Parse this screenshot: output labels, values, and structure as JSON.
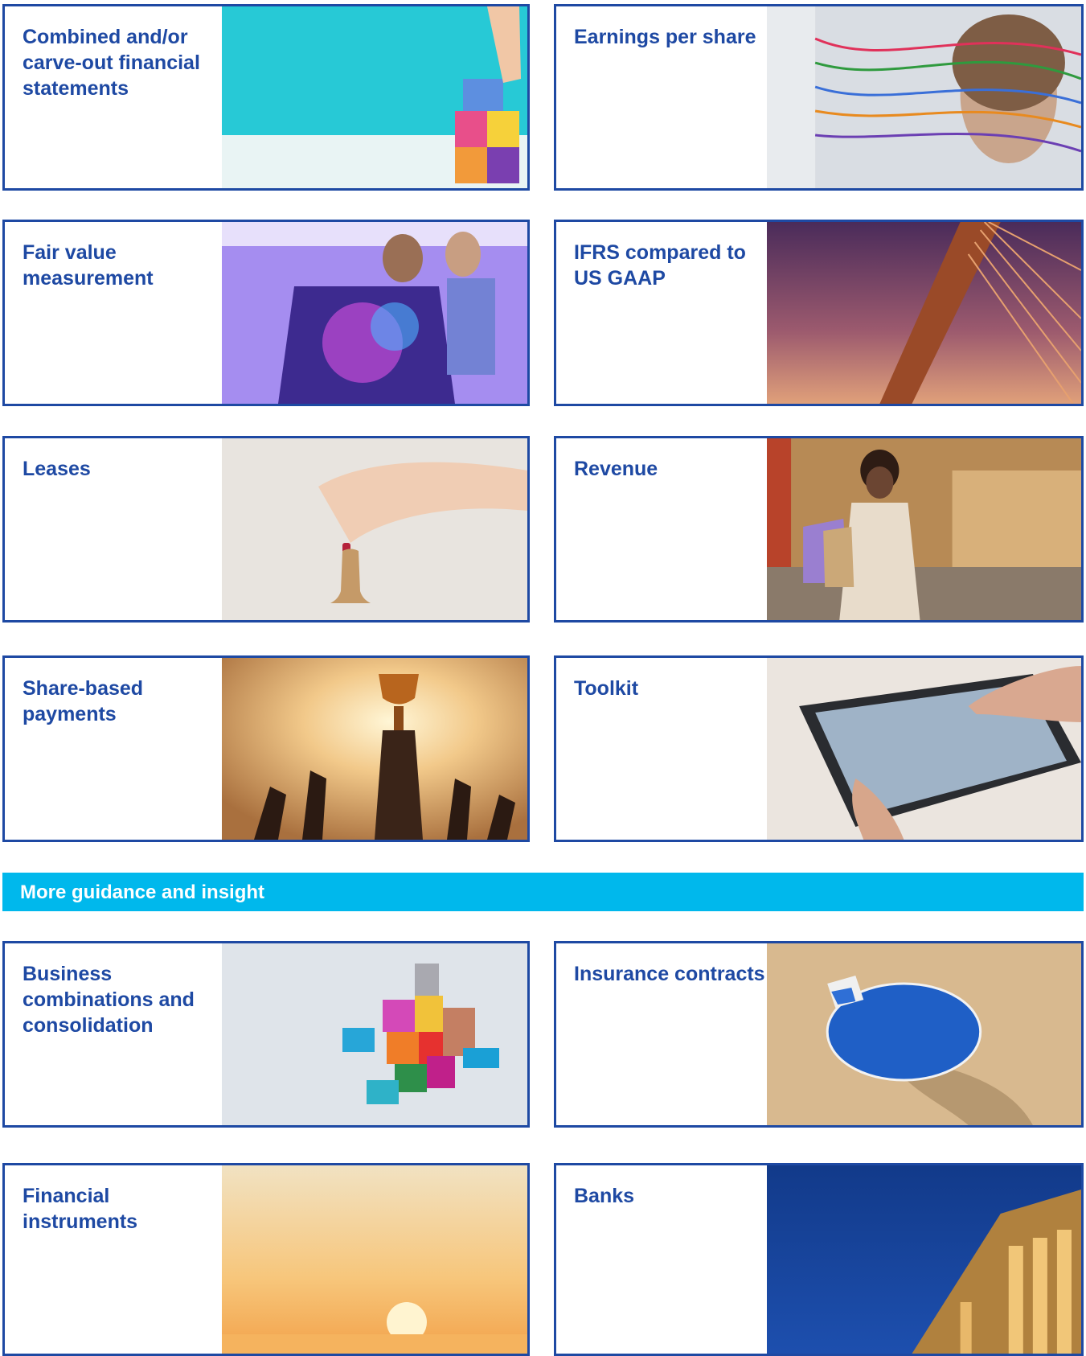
{
  "cards": {
    "combined_carve_out": {
      "title": "Combined and/or carve-out financial statements"
    },
    "earnings_per_share": {
      "title": "Earnings per share"
    },
    "fair_value": {
      "title": "Fair value measurement"
    },
    "ifrs_vs_gaap": {
      "title": "IFRS compared to US GAAP"
    },
    "leases": {
      "title": "Leases"
    },
    "revenue": {
      "title": "Revenue"
    },
    "share_based": {
      "title": "Share-based payments"
    },
    "toolkit": {
      "title": "Toolkit"
    },
    "business_combinations": {
      "title": "Business combinations and consolidation"
    },
    "insurance": {
      "title": "Insurance contracts"
    },
    "financial_instruments": {
      "title": "Financial instruments"
    },
    "banks": {
      "title": "Banks"
    }
  },
  "banner": {
    "label": "More guidance and insight"
  },
  "colors": {
    "border": "#1e49a3",
    "title": "#1e49a3",
    "banner": "#00b8ec"
  }
}
